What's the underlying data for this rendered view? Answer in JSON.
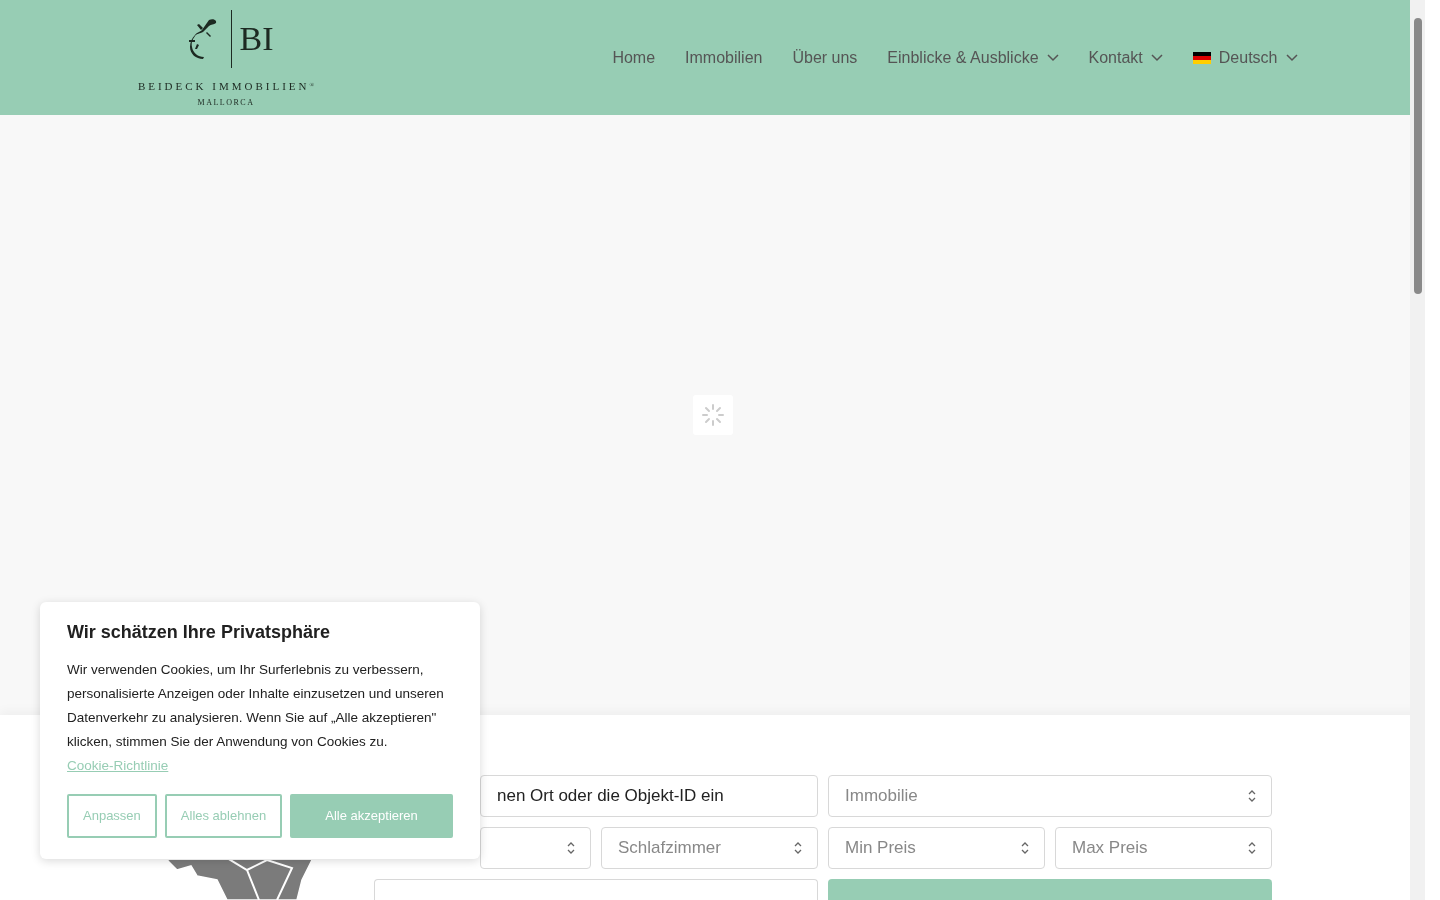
{
  "logo": {
    "monogram": "BI",
    "name": "BEIDECK IMMOBILIEN",
    "mark": "®",
    "region": "MALLORCA"
  },
  "nav": [
    {
      "label": "Home",
      "dropdown": false
    },
    {
      "label": "Immobilien",
      "dropdown": false
    },
    {
      "label": "Über uns",
      "dropdown": false
    },
    {
      "label": "Einblicke & Ausblicke",
      "dropdown": true
    },
    {
      "label": "Kontakt",
      "dropdown": true
    },
    {
      "label": "Deutsch",
      "dropdown": true,
      "kind": "language"
    }
  ],
  "search": {
    "query": "nen Ort oder die Objekt-ID ein",
    "fields": [
      {
        "placeholder": "Immobilie"
      },
      {
        "placeholder": "Schlafzimmer"
      },
      {
        "placeholder": "Min Preis"
      },
      {
        "placeholder": "Max Preis"
      }
    ]
  },
  "cookie_banner": {
    "title": "Wir schätzen Ihre Privatsphäre",
    "text": "Wir verwenden Cookies, um Ihr Surferlebnis zu verbessern, personalisierte Anzeigen oder Inhalte einzusetzen und unseren Datenverkehr zu analysieren. Wenn Sie auf „Alle akzeptieren\" klicken, stimmen Sie der Anwendung von Cookies zu.",
    "link": "Cookie-Richtlinie",
    "buttons": [
      {
        "label": "Anpassen",
        "kind": "outline"
      },
      {
        "label": "Alles ablehnen",
        "kind": "outline"
      },
      {
        "label": "Alle akzeptieren",
        "kind": "solid"
      }
    ]
  }
}
